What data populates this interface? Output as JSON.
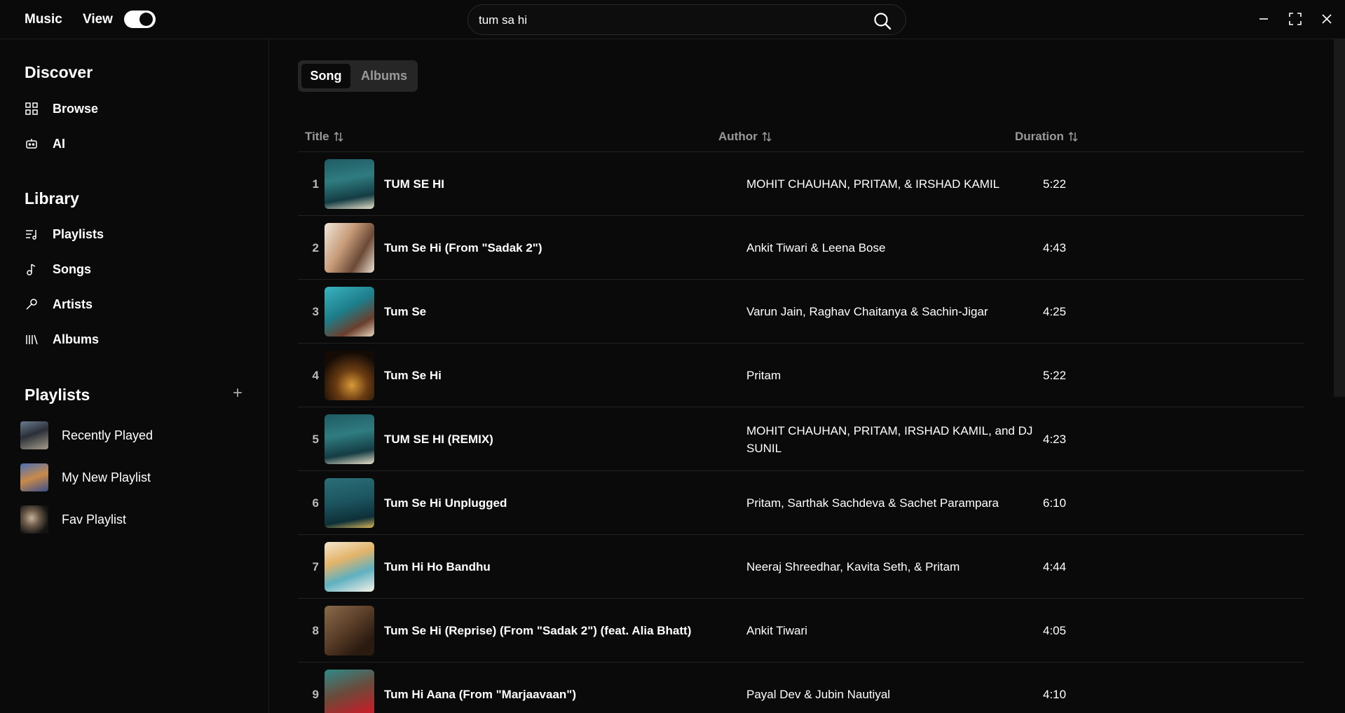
{
  "titlebar": {
    "app_name": "Music",
    "view_label": "View",
    "view_toggle_on": true
  },
  "search": {
    "value": "tum sa hi",
    "placeholder": "Search"
  },
  "sidebar": {
    "discover_title": "Discover",
    "discover_items": [
      {
        "label": "Browse",
        "icon": "grid-icon"
      },
      {
        "label": "AI",
        "icon": "robot-icon"
      }
    ],
    "library_title": "Library",
    "library_items": [
      {
        "label": "Playlists",
        "icon": "playlist-icon"
      },
      {
        "label": "Songs",
        "icon": "music-note-icon"
      },
      {
        "label": "Artists",
        "icon": "microphone-icon"
      },
      {
        "label": "Albums",
        "icon": "library-icon"
      }
    ],
    "playlists_title": "Playlists",
    "playlists": [
      {
        "label": "Recently Played"
      },
      {
        "label": "My New Playlist"
      },
      {
        "label": "Fav Playlist"
      }
    ]
  },
  "main": {
    "tabs": [
      {
        "label": "Song",
        "active": true
      },
      {
        "label": "Albums",
        "active": false
      }
    ],
    "columns": {
      "title": "Title",
      "author": "Author",
      "duration": "Duration"
    },
    "songs": [
      {
        "num": "1",
        "title": "TUM SE HI",
        "author": "MOHIT CHAUHAN, PRITAM, & IRSHAD KAMIL",
        "duration": "5:22"
      },
      {
        "num": "2",
        "title": "Tum Se Hi (From \"Sadak 2\")",
        "author": "Ankit Tiwari & Leena Bose",
        "duration": "4:43"
      },
      {
        "num": "3",
        "title": "Tum Se",
        "author": "Varun Jain, Raghav Chaitanya & Sachin-Jigar",
        "duration": "4:25"
      },
      {
        "num": "4",
        "title": "Tum Se Hi",
        "author": "Pritam",
        "duration": "5:22"
      },
      {
        "num": "5",
        "title": "TUM SE HI (REMIX)",
        "author": "MOHIT CHAUHAN, PRITAM, IRSHAD KAMIL, and DJ SUNIL",
        "duration": "4:23"
      },
      {
        "num": "6",
        "title": "Tum Se Hi Unplugged",
        "author": "Pritam, Sarthak Sachdeva & Sachet Parampara",
        "duration": "6:10"
      },
      {
        "num": "7",
        "title": "Tum Hi Ho Bandhu",
        "author": "Neeraj Shreedhar, Kavita Seth, & Pritam",
        "duration": "4:44"
      },
      {
        "num": "8",
        "title": "Tum Se Hi (Reprise) (From \"Sadak 2\") (feat. Alia Bhatt)",
        "author": "Ankit Tiwari",
        "duration": "4:05"
      },
      {
        "num": "9",
        "title": "Tum Hi Aana (From \"Marjaavaan\")",
        "author": "Payal Dev & Jubin Nautiyal",
        "duration": "4:10"
      }
    ]
  },
  "colors": {
    "background": "#0a0a0a",
    "text": "#ffffff",
    "muted": "#9a9a9a",
    "divider": "#222222"
  }
}
